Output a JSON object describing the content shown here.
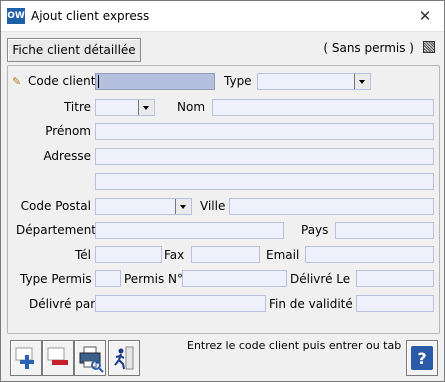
{
  "window": {
    "title": "Ajout client express",
    "app_icon": "OW"
  },
  "toolbar": {
    "fiche_label": "Fiche client détaillée",
    "sans_permis_label": "( Sans permis )"
  },
  "form": {
    "code_client_label": "Code client",
    "code_client_value": "",
    "type_label": "Type",
    "type_value": "",
    "titre_label": "Titre",
    "titre_value": "",
    "nom_label": "Nom",
    "prenom_label": "Prénom",
    "adresse_label": "Adresse",
    "code_postal_label": "Code Postal",
    "ville_label": "Ville",
    "departement_label": "Département",
    "pays_label": "Pays",
    "tel_label": "Tél",
    "fax_label": "Fax",
    "email_label": "Email",
    "type_permis_label": "Type Permis",
    "permis_no_label": "Permis N°",
    "delivre_le_label": "Délivré Le",
    "delivre_par_label": "Délivré par",
    "fin_validite_label": "Fin de validité"
  },
  "footer": {
    "help_text": "Entrez le code client puis entrer ou tab",
    "buttons": [
      {
        "icon": "add-icon"
      },
      {
        "icon": "remove-icon"
      },
      {
        "icon": "print-preview-icon"
      },
      {
        "icon": "exit-runner-icon"
      },
      {
        "icon": "help-icon"
      }
    ]
  },
  "colors": {
    "field_bg": "#eef0fb",
    "field_active_bg": "#b4c0dd",
    "window_bg": "#f0f0f0"
  }
}
